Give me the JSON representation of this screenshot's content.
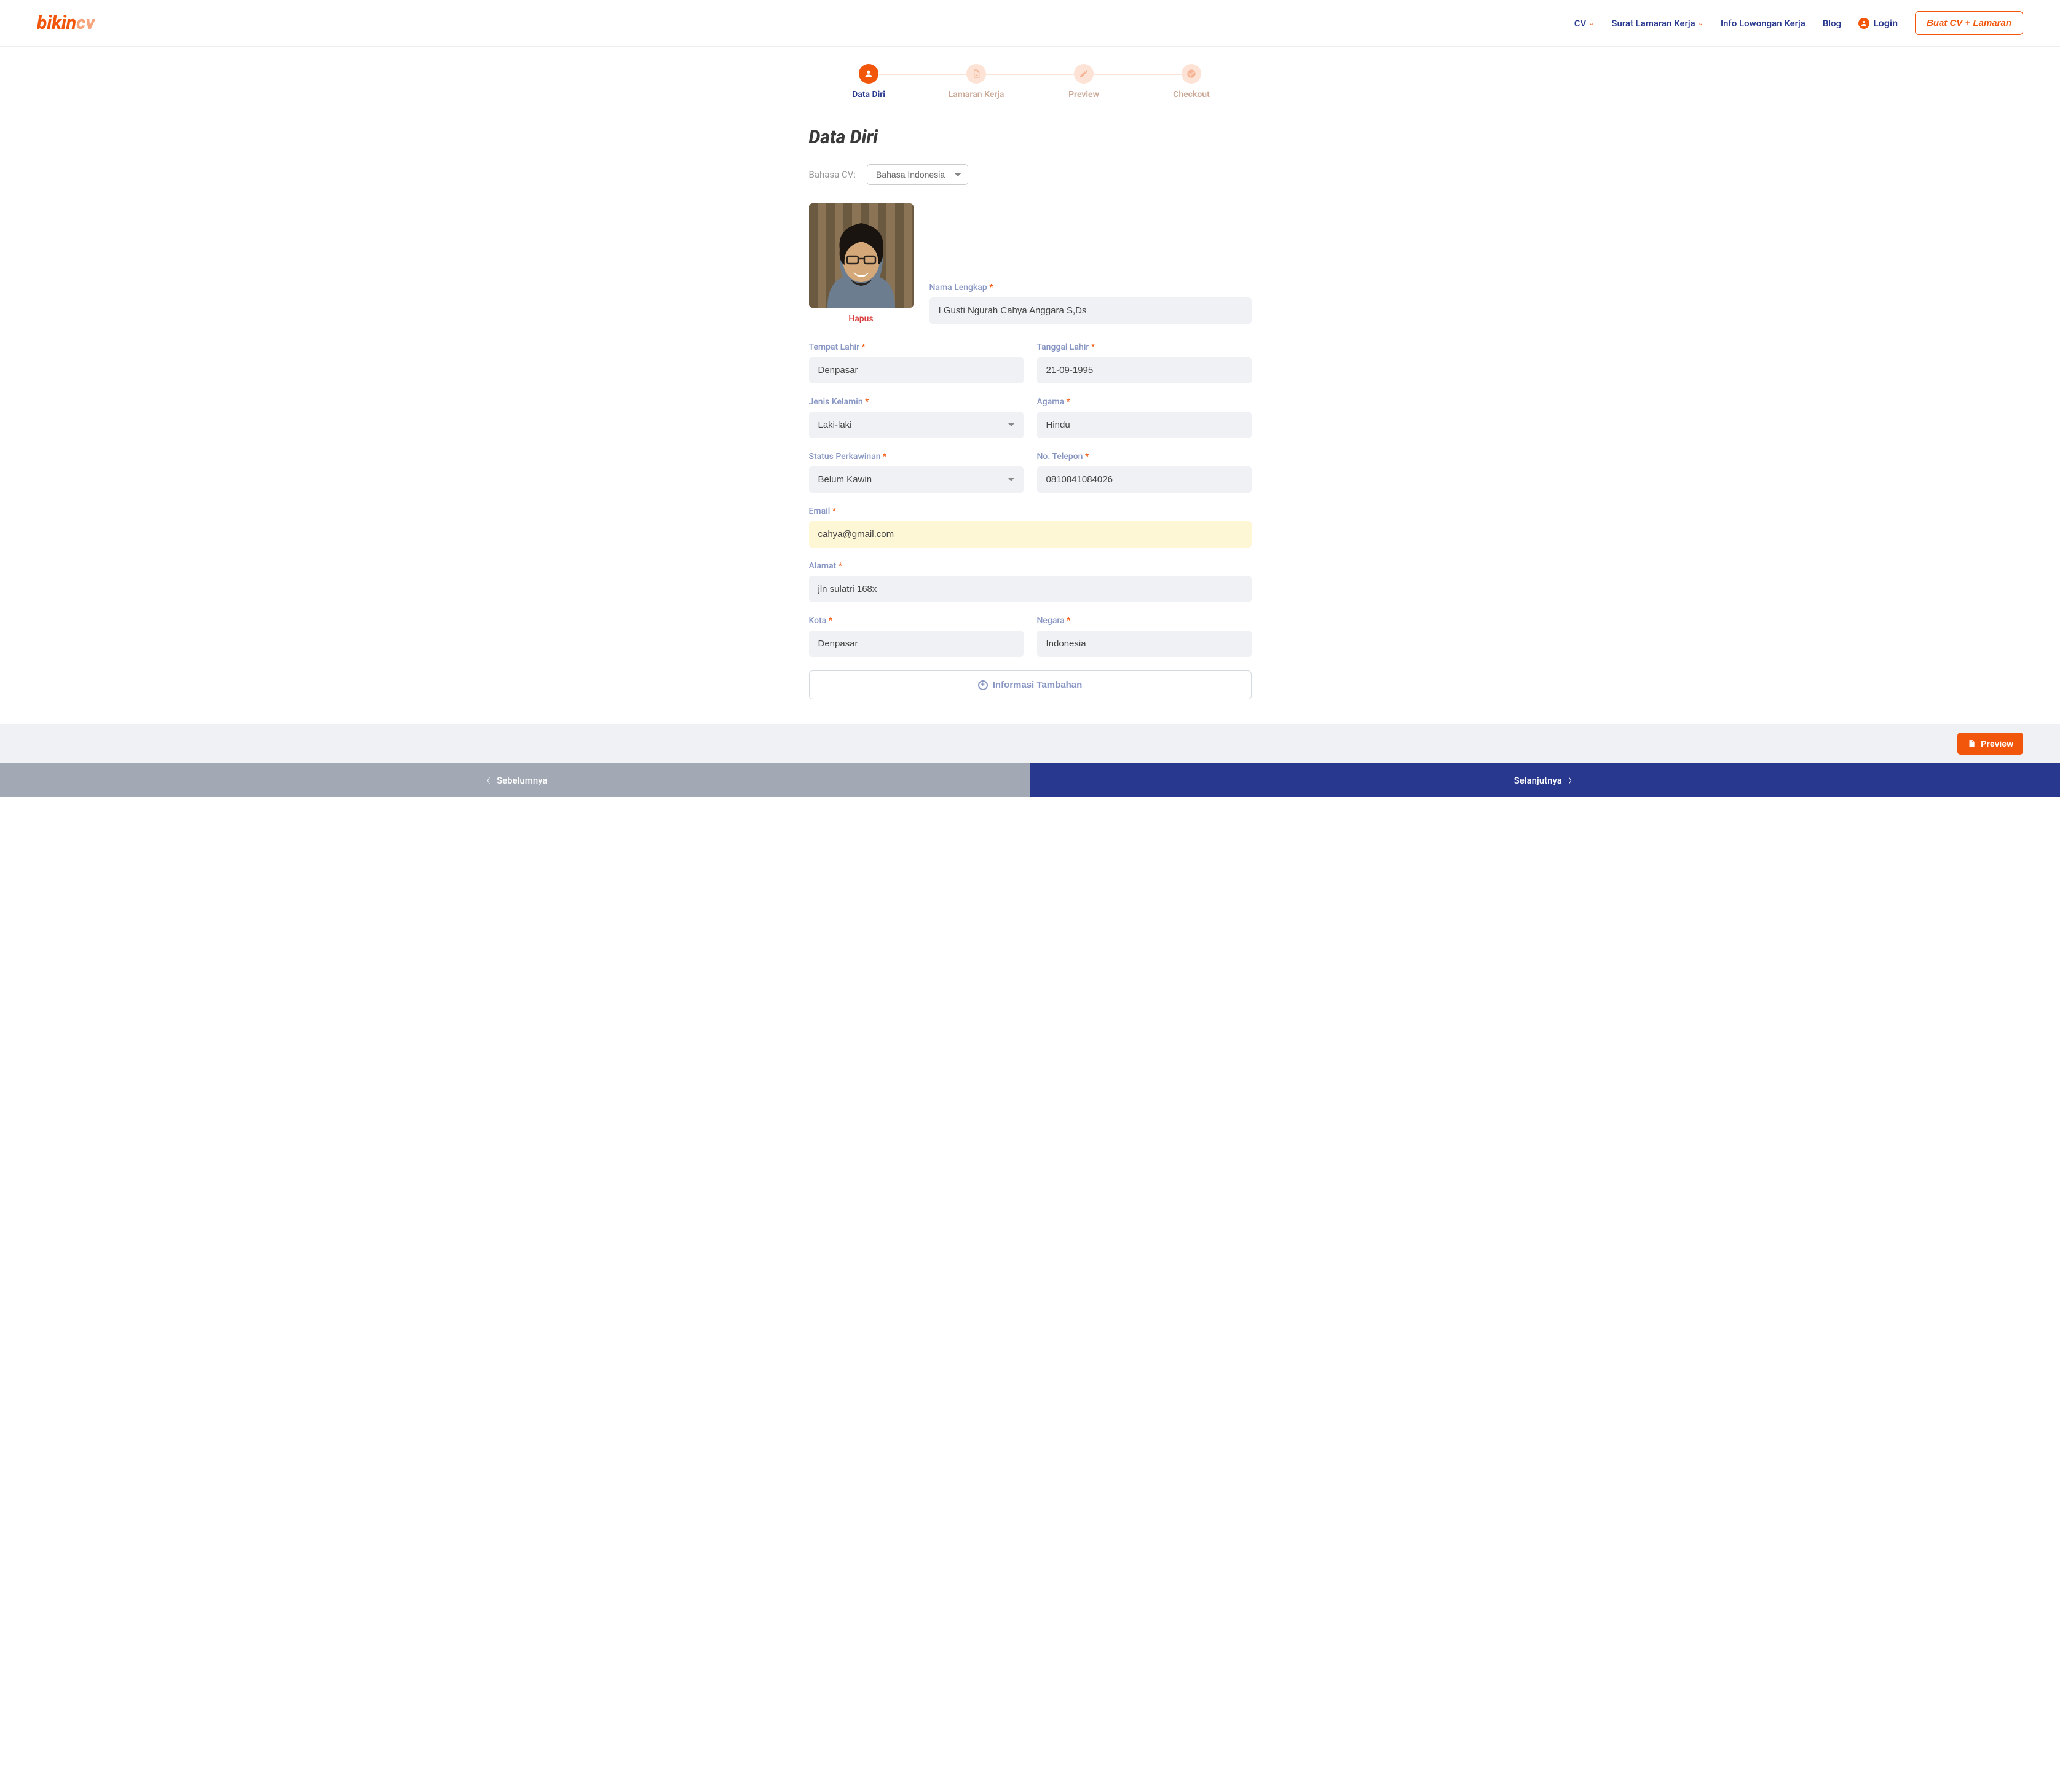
{
  "nav": {
    "logo1": "bikin",
    "logo2": "cv",
    "links": [
      "CV",
      "Surat Lamaran Kerja",
      "Info Lowongan Kerja",
      "Blog"
    ],
    "login": "Login",
    "cta": "Buat CV + Lamaran"
  },
  "steps": [
    {
      "label": "Data Diri",
      "active": true
    },
    {
      "label": "Lamaran Kerja",
      "active": false
    },
    {
      "label": "Preview",
      "active": false
    },
    {
      "label": "Checkout",
      "active": false
    }
  ],
  "page": {
    "title": "Data Diri",
    "langLabel": "Bahasa CV:",
    "langValue": "Bahasa Indonesia",
    "hapus": "Hapus",
    "addInfo": "Informasi Tambahan",
    "previewBtn": "Preview",
    "back": "Sebelumnya",
    "next": "Selanjutnya"
  },
  "fields": {
    "nama": {
      "label": "Nama Lengkap",
      "value": "I Gusti Ngurah Cahya Anggara S,Ds"
    },
    "tempat": {
      "label": "Tempat Lahir",
      "value": "Denpasar"
    },
    "tanggal": {
      "label": "Tanggal Lahir",
      "value": "21-09-1995"
    },
    "kelamin": {
      "label": "Jenis Kelamin",
      "value": "Laki-laki"
    },
    "agama": {
      "label": "Agama",
      "value": "Hindu"
    },
    "status": {
      "label": "Status Perkawinan",
      "value": "Belum Kawin"
    },
    "telepon": {
      "label": "No. Telepon",
      "value": "0810841084026"
    },
    "email": {
      "label": "Email",
      "value": "cahya@gmail.com"
    },
    "alamat": {
      "label": "Alamat",
      "value": "jln sulatri 168x"
    },
    "kota": {
      "label": "Kota",
      "value": "Denpasar"
    },
    "negara": {
      "label": "Negara",
      "value": "Indonesia"
    }
  }
}
